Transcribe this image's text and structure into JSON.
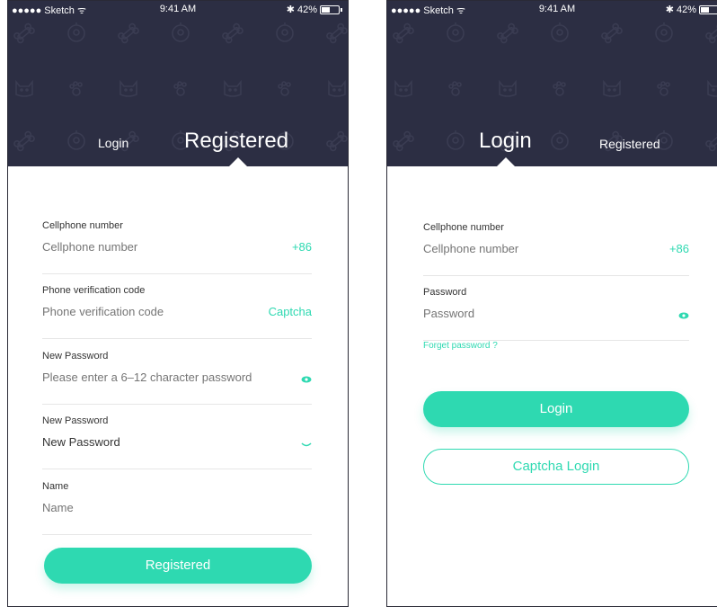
{
  "colors": {
    "header_bg": "#2c2e43",
    "accent": "#2ed9b1",
    "pattern": "#3a3c52"
  },
  "status_bar": {
    "carrier": "●●●●● Sketch ᯤ",
    "time": "9:41 AM",
    "battery": "42%",
    "bluetooth": "✱",
    "battery_level": 0.42
  },
  "register_screen": {
    "tabs": {
      "login": "Login",
      "registered": "Registered"
    },
    "fields": {
      "phone": {
        "label": "Cellphone number",
        "placeholder": "Cellphone number",
        "suffix": "+86"
      },
      "code": {
        "label": "Phone verification code",
        "placeholder": "Phone verification code",
        "suffix": "Captcha"
      },
      "password": {
        "label": "New Password",
        "placeholder": "Please enter a 6–12 character password",
        "icon": "eye-icon"
      },
      "password_confirm": {
        "label": "New Password",
        "value": "New Password",
        "icon": "eye-closed-icon"
      },
      "name": {
        "label": "Name",
        "placeholder": "Name"
      }
    },
    "submit_label": "Registered"
  },
  "login_screen": {
    "tabs": {
      "login": "Login",
      "registered": "Registered"
    },
    "fields": {
      "phone": {
        "label": "Cellphone number",
        "placeholder": "Cellphone number",
        "suffix": "+86"
      },
      "password": {
        "label": "Password",
        "placeholder": "Password",
        "icon": "eye-icon"
      }
    },
    "forgot_label": "Forget password ?",
    "login_label": "Login",
    "captcha_login_label": "Captcha Login"
  }
}
